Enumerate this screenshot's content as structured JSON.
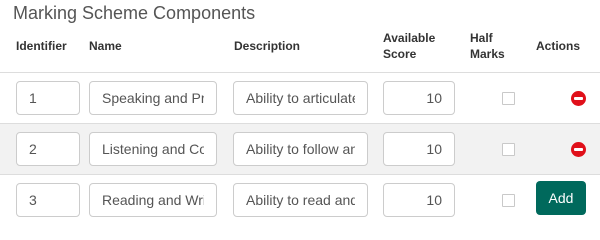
{
  "section_title": "Marking Scheme Components",
  "columns": {
    "identifier": "Identifier",
    "name": "Name",
    "description": "Description",
    "score_line1": "Available",
    "score_line2": "Score",
    "half_line1": "Half",
    "half_line2": "Marks",
    "actions": "Actions"
  },
  "rows": [
    {
      "identifier": "1",
      "name": "Speaking and Presentation",
      "description": "Ability to articulate",
      "score": "10",
      "half_marks": false,
      "action": "delete"
    },
    {
      "identifier": "2",
      "name": "Listening and Comprehension",
      "description": "Ability to follow and",
      "score": "10",
      "half_marks": false,
      "action": "delete"
    },
    {
      "identifier": "3",
      "name": "Reading and Writing",
      "description": "Ability to read and",
      "score": "10",
      "half_marks": false,
      "action": "add"
    }
  ],
  "add_label": "Add",
  "colors": {
    "accent": "#00695c",
    "delete": "#e0101a",
    "row_stripe": "#f2f2f2"
  },
  "icons": {
    "delete": "minus-circle-icon"
  }
}
